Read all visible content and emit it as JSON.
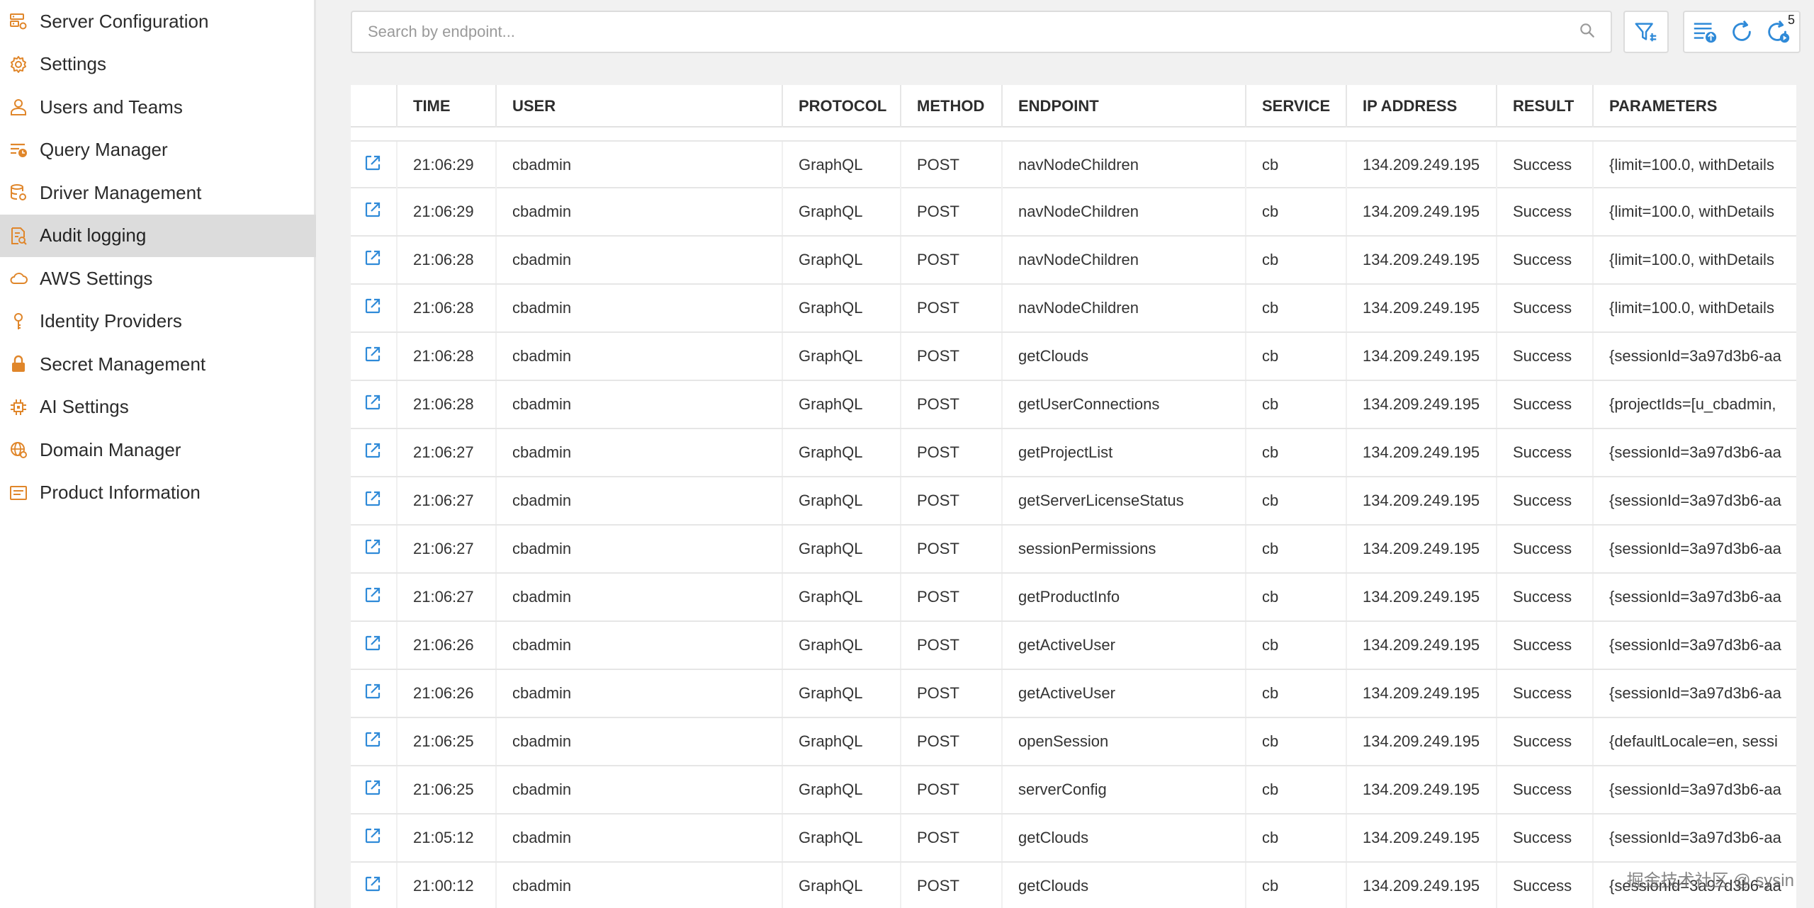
{
  "sidebar": {
    "items": [
      {
        "label": "Server Configuration",
        "icon": "server-config-icon",
        "active": false
      },
      {
        "label": "Settings",
        "icon": "gear-icon",
        "active": false
      },
      {
        "label": "Users and Teams",
        "icon": "user-icon",
        "active": false
      },
      {
        "label": "Query Manager",
        "icon": "query-manager-icon",
        "active": false
      },
      {
        "label": "Driver Management",
        "icon": "database-icon",
        "active": false
      },
      {
        "label": "Audit logging",
        "icon": "audit-log-icon",
        "active": true
      },
      {
        "label": "AWS Settings",
        "icon": "cloud-icon",
        "active": false
      },
      {
        "label": "Identity Providers",
        "icon": "key-icon",
        "active": false
      },
      {
        "label": "Secret Management",
        "icon": "lock-icon",
        "active": false
      },
      {
        "label": "AI Settings",
        "icon": "chip-icon",
        "active": false
      },
      {
        "label": "Domain Manager",
        "icon": "globe-icon",
        "active": false
      },
      {
        "label": "Product Information",
        "icon": "document-icon",
        "active": false
      }
    ]
  },
  "toolbar": {
    "search_placeholder": "Search by endpoint...",
    "search_value": "",
    "filter_icon": "filter-icon",
    "columns_icon": "list-settings-icon",
    "refresh_icon": "refresh-icon",
    "auto_refresh_icon": "timer-refresh-icon",
    "auto_refresh_badge": "5"
  },
  "table": {
    "columns": [
      "",
      "TIME",
      "USER",
      "PROTOCOL",
      "METHOD",
      "ENDPOINT",
      "SERVICE",
      "IP ADDRESS",
      "RESULT",
      "PARAMETERS"
    ],
    "rows": [
      {
        "time": "21:06:29",
        "user": "cbadmin",
        "protocol": "GraphQL",
        "method": "POST",
        "endpoint": "navNodeChildren",
        "service": "cb",
        "ip": "134.209.249.195",
        "result": "Success",
        "parameters": "{limit=100.0, withDetails"
      },
      {
        "time": "21:06:29",
        "user": "cbadmin",
        "protocol": "GraphQL",
        "method": "POST",
        "endpoint": "navNodeChildren",
        "service": "cb",
        "ip": "134.209.249.195",
        "result": "Success",
        "parameters": "{limit=100.0, withDetails"
      },
      {
        "time": "21:06:28",
        "user": "cbadmin",
        "protocol": "GraphQL",
        "method": "POST",
        "endpoint": "navNodeChildren",
        "service": "cb",
        "ip": "134.209.249.195",
        "result": "Success",
        "parameters": "{limit=100.0, withDetails"
      },
      {
        "time": "21:06:28",
        "user": "cbadmin",
        "protocol": "GraphQL",
        "method": "POST",
        "endpoint": "navNodeChildren",
        "service": "cb",
        "ip": "134.209.249.195",
        "result": "Success",
        "parameters": "{limit=100.0, withDetails"
      },
      {
        "time": "21:06:28",
        "user": "cbadmin",
        "protocol": "GraphQL",
        "method": "POST",
        "endpoint": "getClouds",
        "service": "cb",
        "ip": "134.209.249.195",
        "result": "Success",
        "parameters": "{sessionId=3a97d3b6-aa"
      },
      {
        "time": "21:06:28",
        "user": "cbadmin",
        "protocol": "GraphQL",
        "method": "POST",
        "endpoint": "getUserConnections",
        "service": "cb",
        "ip": "134.209.249.195",
        "result": "Success",
        "parameters": "{projectIds=[u_cbadmin,"
      },
      {
        "time": "21:06:27",
        "user": "cbadmin",
        "protocol": "GraphQL",
        "method": "POST",
        "endpoint": "getProjectList",
        "service": "cb",
        "ip": "134.209.249.195",
        "result": "Success",
        "parameters": "{sessionId=3a97d3b6-aa"
      },
      {
        "time": "21:06:27",
        "user": "cbadmin",
        "protocol": "GraphQL",
        "method": "POST",
        "endpoint": "getServerLicenseStatus",
        "service": "cb",
        "ip": "134.209.249.195",
        "result": "Success",
        "parameters": "{sessionId=3a97d3b6-aa"
      },
      {
        "time": "21:06:27",
        "user": "cbadmin",
        "protocol": "GraphQL",
        "method": "POST",
        "endpoint": "sessionPermissions",
        "service": "cb",
        "ip": "134.209.249.195",
        "result": "Success",
        "parameters": "{sessionId=3a97d3b6-aa"
      },
      {
        "time": "21:06:27",
        "user": "cbadmin",
        "protocol": "GraphQL",
        "method": "POST",
        "endpoint": "getProductInfo",
        "service": "cb",
        "ip": "134.209.249.195",
        "result": "Success",
        "parameters": "{sessionId=3a97d3b6-aa"
      },
      {
        "time": "21:06:26",
        "user": "cbadmin",
        "protocol": "GraphQL",
        "method": "POST",
        "endpoint": "getActiveUser",
        "service": "cb",
        "ip": "134.209.249.195",
        "result": "Success",
        "parameters": "{sessionId=3a97d3b6-aa"
      },
      {
        "time": "21:06:26",
        "user": "cbadmin",
        "protocol": "GraphQL",
        "method": "POST",
        "endpoint": "getActiveUser",
        "service": "cb",
        "ip": "134.209.249.195",
        "result": "Success",
        "parameters": "{sessionId=3a97d3b6-aa"
      },
      {
        "time": "21:06:25",
        "user": "cbadmin",
        "protocol": "GraphQL",
        "method": "POST",
        "endpoint": "openSession",
        "service": "cb",
        "ip": "134.209.249.195",
        "result": "Success",
        "parameters": "{defaultLocale=en, sessi"
      },
      {
        "time": "21:06:25",
        "user": "cbadmin",
        "protocol": "GraphQL",
        "method": "POST",
        "endpoint": "serverConfig",
        "service": "cb",
        "ip": "134.209.249.195",
        "result": "Success",
        "parameters": "{sessionId=3a97d3b6-aa"
      },
      {
        "time": "21:05:12",
        "user": "cbadmin",
        "protocol": "GraphQL",
        "method": "POST",
        "endpoint": "getClouds",
        "service": "cb",
        "ip": "134.209.249.195",
        "result": "Success",
        "parameters": "{sessionId=3a97d3b6-aa"
      },
      {
        "time": "21:00:12",
        "user": "cbadmin",
        "protocol": "GraphQL",
        "method": "POST",
        "endpoint": "getClouds",
        "service": "cb",
        "ip": "134.209.249.195",
        "result": "Success",
        "parameters": "{sessionId=3a97d3b6-aa"
      }
    ]
  },
  "watermark": "掘金技术社区 @ sysin",
  "colors": {
    "accent_orange": "#e0862a",
    "accent_blue": "#2f8ad8",
    "active_bg": "#dcdcdc"
  }
}
